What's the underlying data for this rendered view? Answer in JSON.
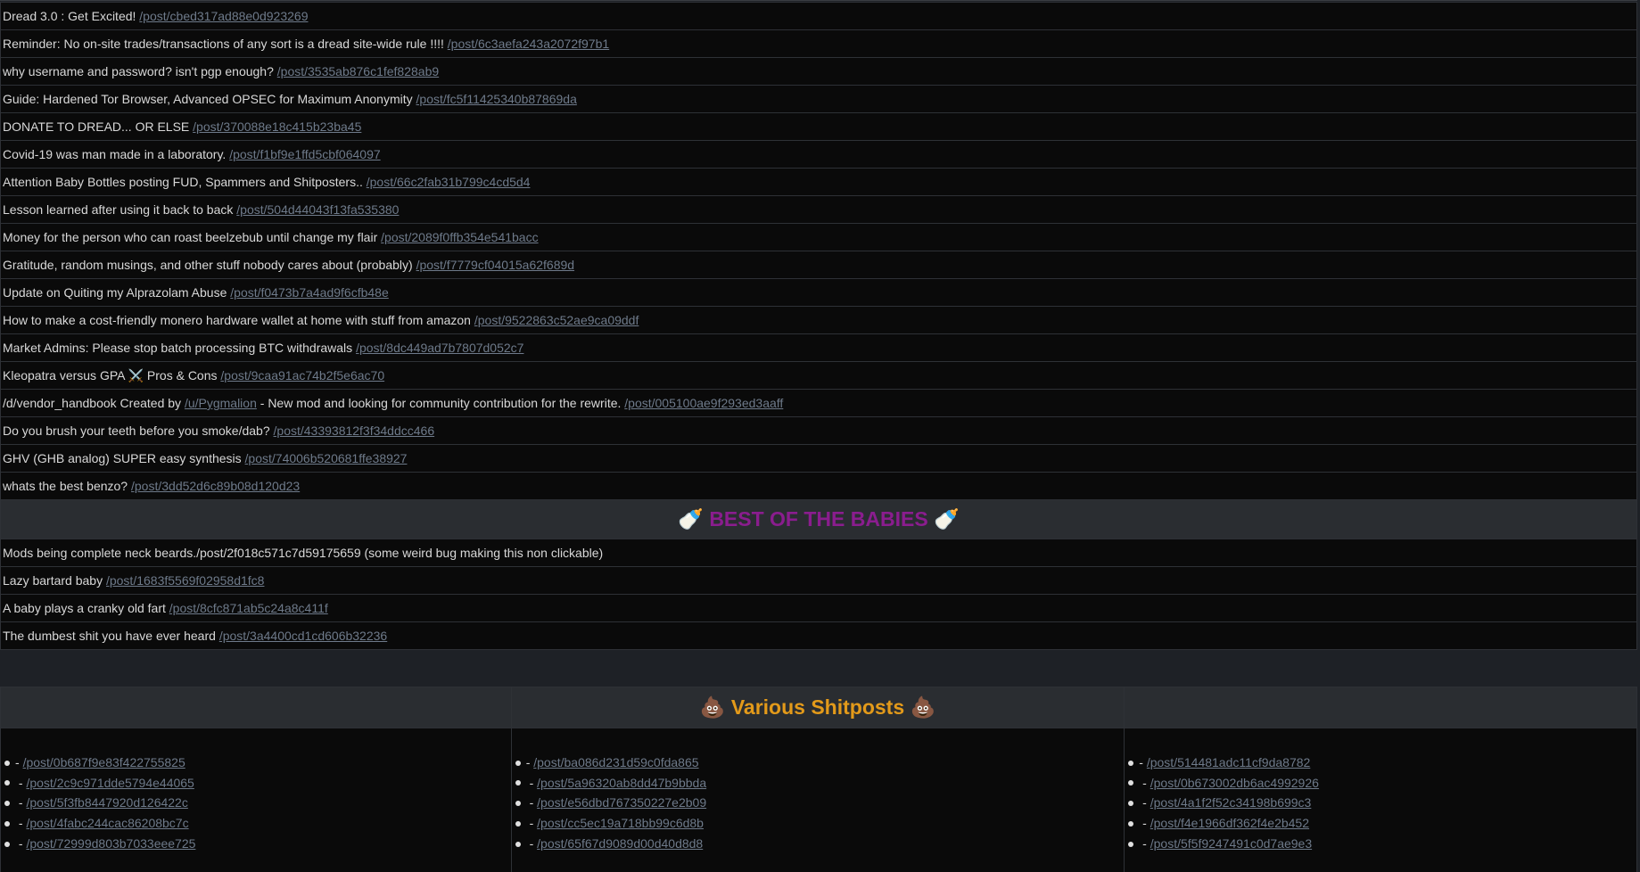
{
  "posts_top": [
    {
      "text": "Dread 3.0 : Get Excited! ",
      "link": "/post/cbed317ad88e0d923269"
    },
    {
      "text": "Reminder: No on-site trades/transactions of any sort is a dread site-wide rule !!!! ",
      "link": "/post/6c3aefa243a2072f97b1"
    },
    {
      "text": "why username and password? isn't pgp enough? ",
      "link": "/post/3535ab876c1fef828ab9"
    },
    {
      "text": "Guide: Hardened Tor Browser, Advanced OPSEC for Maximum Anonymity ",
      "link": "/post/fc5f11425340b87869da"
    },
    {
      "text": "DONATE TO DREAD... OR ELSE ",
      "link": "/post/370088e18c415b23ba45"
    },
    {
      "text": "Covid-19 was man made in a laboratory. ",
      "link": "/post/f1bf9e1ffd5cbf064097"
    },
    {
      "text": "Attention Baby Bottles posting FUD, Spammers and Shitposters.. ",
      "link": "/post/66c2fab31b799c4cd5d4"
    },
    {
      "text": "Lesson learned after using it back to back ",
      "link": "/post/504d44043f13fa535380"
    },
    {
      "text": "Money for the person who can roast beelzebub until change my flair ",
      "link": "/post/2089f0ffb354e541bacc"
    },
    {
      "text": "Gratitude, random musings, and other stuff nobody cares about (probably) ",
      "link": "/post/f7779cf04015a62f689d"
    },
    {
      "text": "Update on Quiting my Alprazolam Abuse ",
      "link": "/post/f0473b7a4ad9f6cfb48e"
    },
    {
      "text": "How to make a cost-friendly monero hardware wallet at home with stuff from amazon ",
      "link": "/post/9522863c52ae9ca09ddf"
    },
    {
      "text": "Market Admins: Please stop batch processing BTC withdrawals ",
      "link": "/post/8dc449ad7b7807d052c7"
    },
    {
      "text": "Kleopatra versus GPA ⚔️ Pros & Cons ",
      "link": "/post/9caa91ac74b2f5e6ac70"
    }
  ],
  "vendor_row": {
    "prefix": "/d/vendor_handbook Created by ",
    "user_link": "/u/Pygmalion",
    "middle": " - New mod and looking for community contribution for the rewrite. ",
    "link": "/post/005100ae9f293ed3aaff"
  },
  "posts_mid": [
    {
      "text": "Do you brush your teeth before you smoke/dab? ",
      "link": "/post/43393812f3f34ddcc466"
    },
    {
      "text": "GHV (GHB analog) SUPER easy synthesis ",
      "link": "/post/74006b520681ffe38927"
    },
    {
      "text": "whats the best benzo? ",
      "link": "/post/3dd52d6c89b08d120d23"
    }
  ],
  "babies": {
    "heading": "BEST OF THE BABIES",
    "heading_icon": "🍼",
    "heading_color": "#8a1d8e",
    "plain_row": "Mods being complete neck beards./post/2f018c571c7d59175659 (some weird bug making this non clickable)",
    "rows": [
      {
        "text": "Lazy bartard baby ",
        "link": "/post/1683f5569f02958d1fc8"
      },
      {
        "text": "A baby plays a cranky old fart ",
        "link": "/post/8cfc871ab5c24a8c411f"
      },
      {
        "text": "The dumbest shit you have ever heard ",
        "link": "/post/3a4400cd1cd606b32236"
      }
    ]
  },
  "shitposts": {
    "heading": "Various Shitposts",
    "heading_icon": "💩",
    "heading_color": "#e39a1a",
    "dash": "- ",
    "col1": [
      "/post/0b687f9e83f422755825",
      "/post/2c9c971dde5794e44065",
      "/post/5f3fb8447920d126422c",
      "/post/4fabc244cac86208bc7c",
      "/post/72999d803b7033eee725"
    ],
    "col2": [
      "/post/ba086d231d59c0fda865",
      "/post/5a96320ab8dd47b9bbda",
      "/post/e56dbd767350227e2b09",
      "/post/cc5ec19a718bb99c6d8b",
      "/post/65f67d9089d00d40d8d8"
    ],
    "col3": [
      "/post/514481adc11cf9da8782",
      "/post/0b673002db6ac4992926",
      "/post/4a1f2f52c34198b699c3",
      "/post/f4e1966df362f4e2b452",
      "/post/5f5f9247491c0d7ae9e3"
    ]
  },
  "colors": {
    "background": "#1e2126",
    "row_background": "#0a0a0a",
    "link": "#6e7a8a",
    "text": "#d8d8d8"
  }
}
